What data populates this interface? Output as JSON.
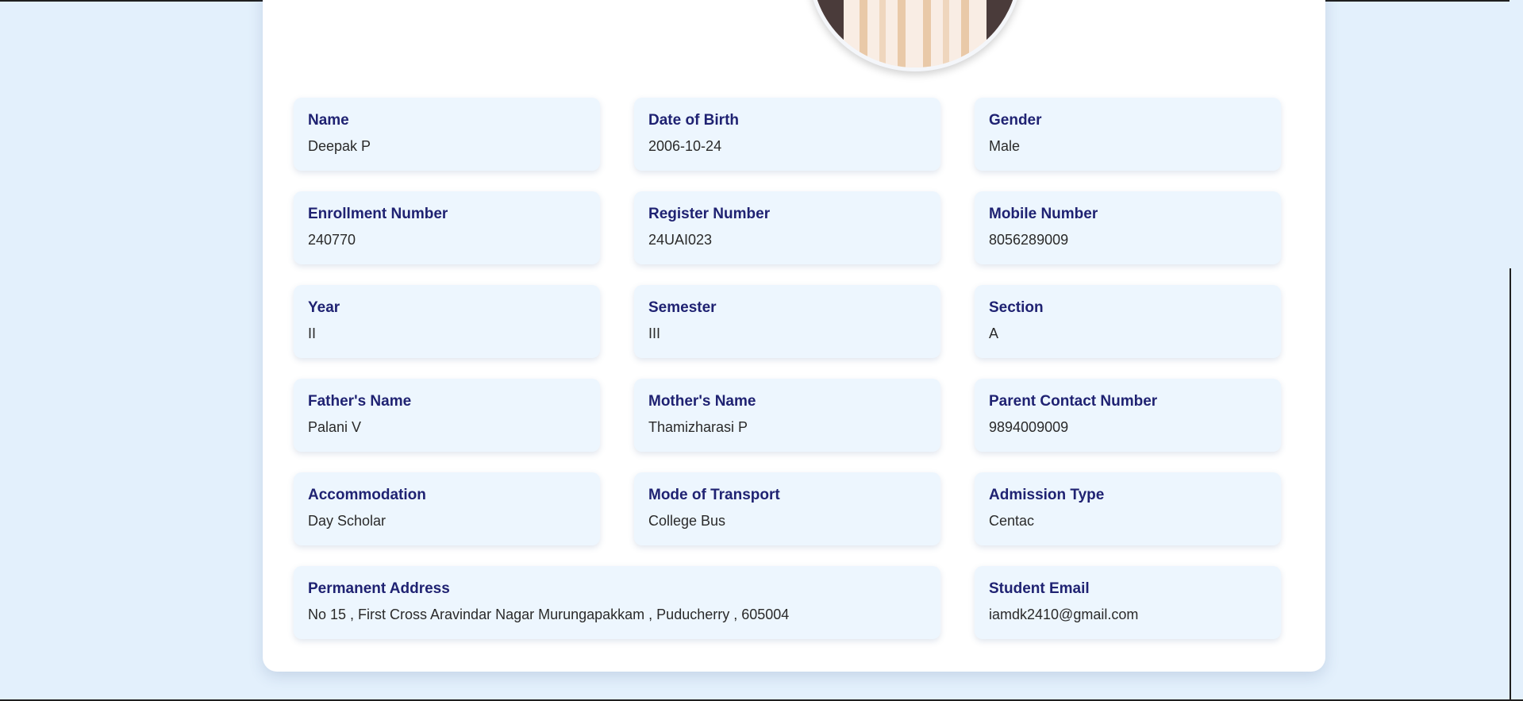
{
  "profile": {
    "photo_alt": "Student photo",
    "fields": [
      {
        "label": "Name",
        "value": "Deepak P"
      },
      {
        "label": "Date of Birth",
        "value": "2006-10-24"
      },
      {
        "label": "Gender",
        "value": "Male"
      },
      {
        "label": "Enrollment Number",
        "value": "240770"
      },
      {
        "label": "Register Number",
        "value": "24UAI023"
      },
      {
        "label": "Mobile Number",
        "value": "8056289009"
      },
      {
        "label": "Year",
        "value": "II"
      },
      {
        "label": "Semester",
        "value": "III"
      },
      {
        "label": "Section",
        "value": "A"
      },
      {
        "label": "Father's Name",
        "value": "Palani V"
      },
      {
        "label": "Mother's Name",
        "value": "Thamizharasi P"
      },
      {
        "label": "Parent Contact Number",
        "value": "9894009009"
      },
      {
        "label": "Accommodation",
        "value": "Day Scholar"
      },
      {
        "label": "Mode of Transport",
        "value": "College Bus"
      },
      {
        "label": "Admission Type",
        "value": "Centac"
      },
      {
        "label": "Permanent Address",
        "value": "No 15 , First Cross Aravindar Nagar Murungapakkam , Puducherry , 605004"
      },
      {
        "label": "Student Email",
        "value": "iamdk2410@gmail.com"
      }
    ]
  },
  "colors": {
    "page_background": "#e3f0fc",
    "card_background": "#ffffff",
    "field_background": "#edf6fe",
    "label_color": "#1f2272",
    "value_color": "#2a2a2a"
  }
}
